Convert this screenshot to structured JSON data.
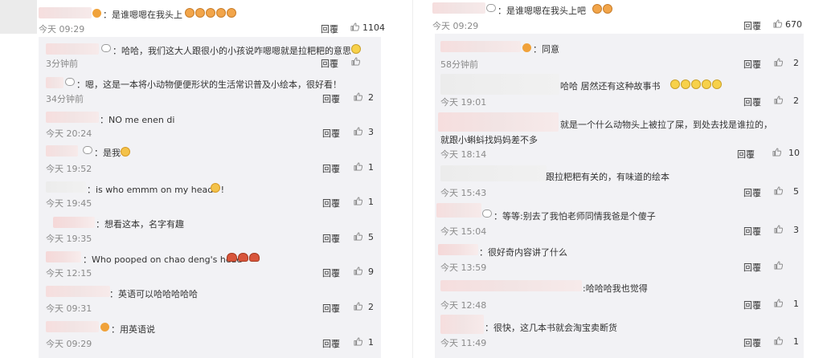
{
  "left": {
    "top": {
      "text": "：是谁嗯嗯在我头上",
      "time": "今天 09:29",
      "reply": "回覆",
      "likes": "1104"
    },
    "replies": [
      {
        "text": "：哈哈，我们这大人跟很小的小孩说咋嗯嗯就是拉粑粑的意思",
        "time": "3分钟前",
        "reply": "回覆",
        "likes": ""
      },
      {
        "text": "：嗯，这是一本将小动物便便形状的生活常识普及小绘本，很好看！",
        "time": "34分钟前",
        "reply": "回覆",
        "likes": "2"
      },
      {
        "text": "：NO me enen di",
        "time": "今天 20:24",
        "reply": "回覆",
        "likes": "3"
      },
      {
        "text": "：是我",
        "time": "今天 19:52",
        "reply": "回覆",
        "likes": "1"
      },
      {
        "text": "：is who emmm on my head? !",
        "time": "今天 19:45",
        "reply": "回覆",
        "likes": "1"
      },
      {
        "text": "：想看这本，名字有趣",
        "time": "今天 19:35",
        "reply": "回覆",
        "likes": "5"
      },
      {
        "text": "：Who pooped on chao deng's head",
        "time": "今天 12:15",
        "reply": "回覆",
        "likes": "9"
      },
      {
        "text": "：英语可以哈哈哈哈哈",
        "time": "今天 09:31",
        "reply": "回覆",
        "likes": "2"
      },
      {
        "text": "：用英语说",
        "time": "今天 09:29",
        "reply": "回覆",
        "likes": "1"
      }
    ]
  },
  "right": {
    "top": {
      "text": "：是谁嗯嗯在我头上吧",
      "time": "今天 09:29",
      "reply": "回覆",
      "likes": "670"
    },
    "replies": [
      {
        "text": "：同意",
        "time": "58分钟前",
        "reply": "回覆",
        "likes": "2"
      },
      {
        "text": "哈哈 居然还有这种故事书",
        "time": "今天 19:01",
        "reply": "回覆",
        "likes": "2"
      },
      {
        "text": "就是一个什么动物头上被拉了屎，到处去找是谁拉的，",
        "text2": "就跟小蝌蚪找妈妈差不多",
        "time": "今天 18:14",
        "reply": "回覆",
        "likes": "10"
      },
      {
        "text": "跟拉粑粑有关的，有味道的绘本",
        "time": "今天 15:43",
        "reply": "回覆",
        "likes": "5"
      },
      {
        "text": "：等等:别去了我怕老师同情我爸是个傻子",
        "time": "今天 15:04",
        "reply": "回覆",
        "likes": "3"
      },
      {
        "text": "：很好奇内容讲了什么",
        "time": "今天 13:59",
        "reply": "回覆",
        "likes": ""
      },
      {
        "text": ":哈哈哈我也觉得",
        "time": "今天 12:48",
        "reply": "回覆",
        "likes": "1"
      },
      {
        "text": "：很快，这几本书就会淘宝卖断货",
        "time": "今天 11:49",
        "reply": "回覆",
        "likes": "1"
      }
    ]
  }
}
